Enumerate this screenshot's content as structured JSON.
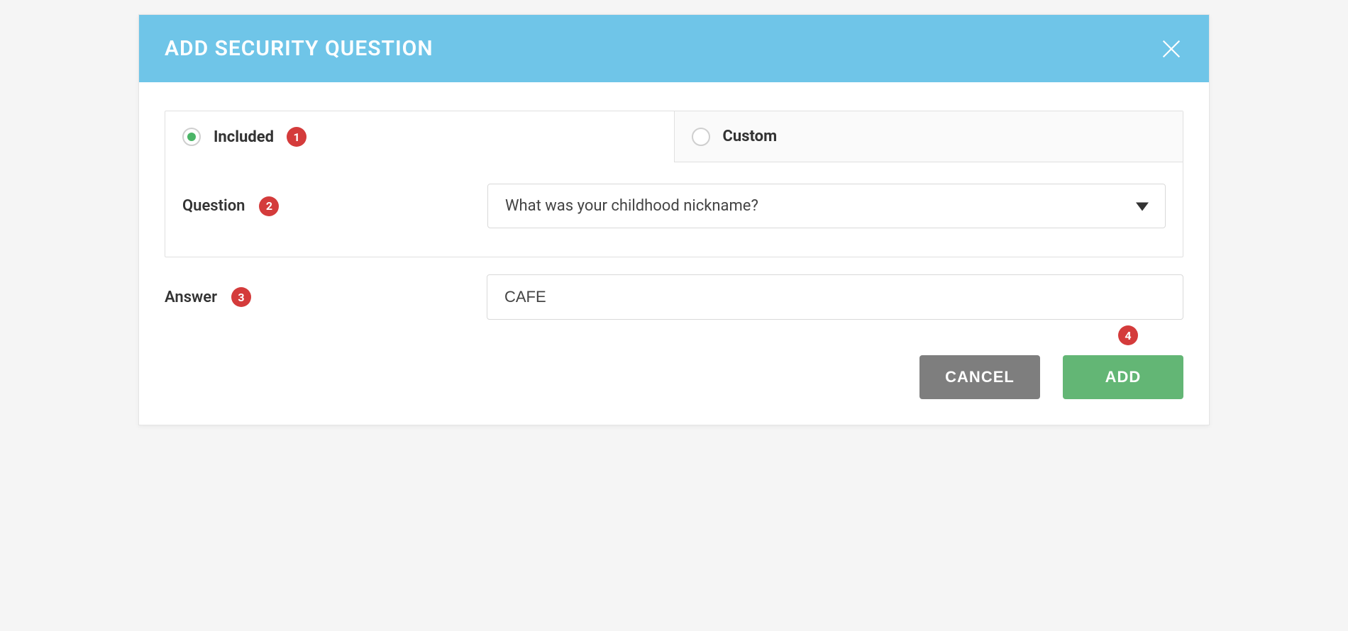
{
  "header": {
    "title": "ADD SECURITY QUESTION"
  },
  "tabs": {
    "included": "Included",
    "custom": "Custom"
  },
  "form": {
    "question_label": "Question",
    "question_selected": "What was your childhood nickname?",
    "answer_label": "Answer",
    "answer_value": "CAFE"
  },
  "callouts": {
    "c1": "1",
    "c2": "2",
    "c3": "3",
    "c4": "4"
  },
  "footer": {
    "cancel": "CANCEL",
    "add": "ADD"
  }
}
